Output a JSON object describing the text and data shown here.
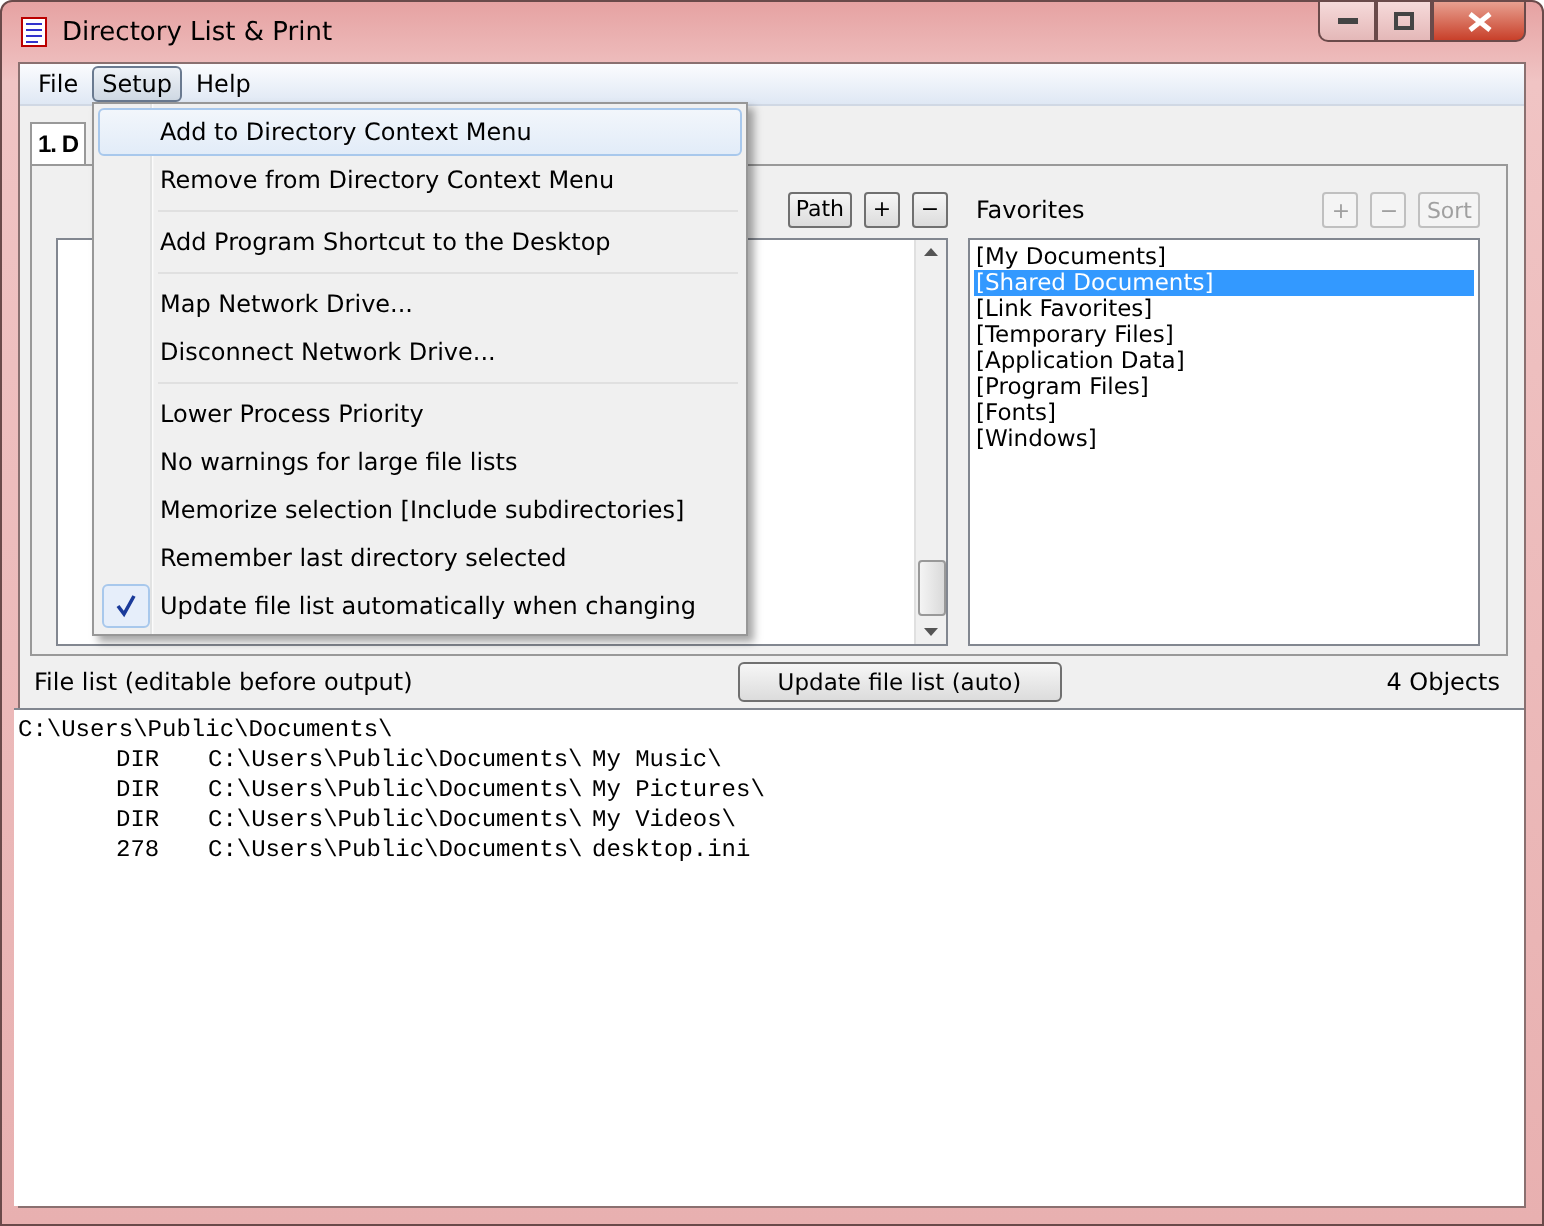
{
  "window": {
    "title": "Directory List & Print"
  },
  "menu_bar": [
    {
      "label": "File",
      "selected": false
    },
    {
      "label": "Setup",
      "selected": true
    },
    {
      "label": "Help",
      "selected": false
    }
  ],
  "setup_menu": [
    {
      "kind": "item",
      "label": "Add to Directory Context Menu",
      "highlighted": true,
      "checked": false
    },
    {
      "kind": "item",
      "label": "Remove from Directory Context Menu",
      "highlighted": false,
      "checked": false
    },
    {
      "kind": "separator"
    },
    {
      "kind": "item",
      "label": "Add Program Shortcut to the Desktop",
      "highlighted": false,
      "checked": false
    },
    {
      "kind": "separator"
    },
    {
      "kind": "item",
      "label": "Map Network Drive...",
      "highlighted": false,
      "checked": false
    },
    {
      "kind": "item",
      "label": "Disconnect Network Drive...",
      "highlighted": false,
      "checked": false
    },
    {
      "kind": "separator"
    },
    {
      "kind": "item",
      "label": "Lower Process Priority",
      "highlighted": false,
      "checked": false
    },
    {
      "kind": "item",
      "label": "No warnings for large file lists",
      "highlighted": false,
      "checked": false
    },
    {
      "kind": "item",
      "label": "Memorize selection [Include subdirectories]",
      "highlighted": false,
      "checked": false
    },
    {
      "kind": "item",
      "label": "Remember last directory selected",
      "highlighted": false,
      "checked": false
    },
    {
      "kind": "item",
      "label": "Update file list automatically when changing",
      "highlighted": false,
      "checked": true
    }
  ],
  "tab": {
    "label": "1. D"
  },
  "directory_buttons": [
    {
      "label": "Path",
      "disabled": false
    },
    {
      "label": "+",
      "disabled": false
    },
    {
      "label": "−",
      "disabled": false
    }
  ],
  "favorites": {
    "title": "Favorites",
    "buttons": [
      {
        "label": "+",
        "disabled": true
      },
      {
        "label": "−",
        "disabled": true
      },
      {
        "label": "Sort",
        "disabled": true
      }
    ],
    "items": [
      {
        "label": "[My Documents]",
        "selected": false
      },
      {
        "label": "[Shared Documents]",
        "selected": true
      },
      {
        "label": "[Link Favorites]",
        "selected": false
      },
      {
        "label": "[Temporary Files]",
        "selected": false
      },
      {
        "label": "[Application Data]",
        "selected": false
      },
      {
        "label": "[Program Files]",
        "selected": false
      },
      {
        "label": "[Fonts]",
        "selected": false
      },
      {
        "label": "[Windows]",
        "selected": false
      }
    ]
  },
  "file_list": {
    "label": "File list (editable before output)",
    "update_button": "Update file list (auto)",
    "count": "4 Objects",
    "header": "C:\\Users\\Public\\Documents\\",
    "rows": [
      {
        "size": "DIR",
        "path": "C:\\Users\\Public\\Documents\\",
        "name": "My Music\\"
      },
      {
        "size": "DIR",
        "path": "C:\\Users\\Public\\Documents\\",
        "name": "My Pictures\\"
      },
      {
        "size": "DIR",
        "path": "C:\\Users\\Public\\Documents\\",
        "name": "My Videos\\"
      },
      {
        "size": "278",
        "path": "C:\\Users\\Public\\Documents\\",
        "name": "desktop.ini"
      }
    ]
  }
}
